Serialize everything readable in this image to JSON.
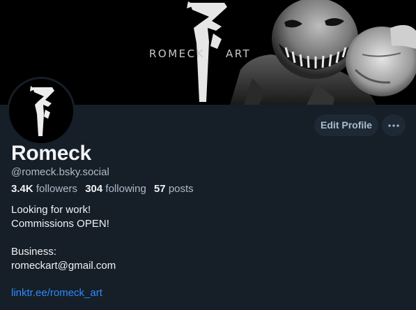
{
  "banner": {
    "brand_left": "ROMECK",
    "brand_right": "ART"
  },
  "profile": {
    "display_name": "Romeck",
    "handle": "@romeck.bsky.social",
    "followers_count": "3.4K",
    "followers_label": "followers",
    "following_count": "304",
    "following_label": "following",
    "posts_count": "57",
    "posts_label": "posts",
    "bio_lines": [
      "Looking for work!",
      "Commissions OPEN!",
      "",
      "Business:",
      "romeckart@gmail.com"
    ],
    "link": "linktr.ee/romeck_art"
  },
  "actions": {
    "edit_label": "Edit Profile",
    "more_icon": "ellipsis-icon"
  },
  "colors": {
    "background": "#161e27",
    "button_bg": "#1e2936",
    "link": "#2a8cff",
    "muted_text": "#aebbc9",
    "primary_text": "#f1f3f5"
  }
}
